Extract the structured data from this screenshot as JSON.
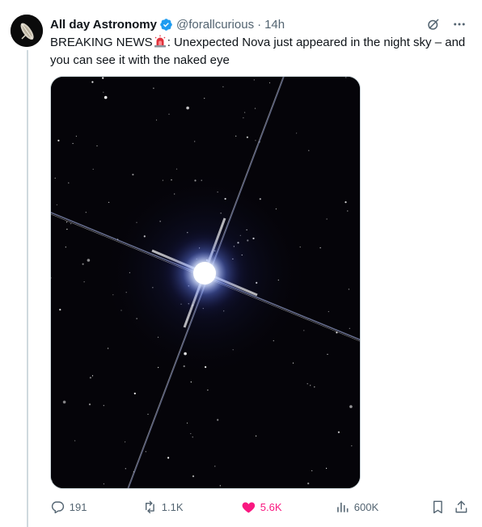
{
  "author": {
    "display_name": "All day Astronomy",
    "handle": "@forallcurious",
    "separator": "·",
    "timestamp": "14h",
    "avatar_icon": "satellite-dish-icon",
    "verified_icon": "verified-badge-icon"
  },
  "tweet": {
    "text_part1": "BREAKING NEWS",
    "emoji_icon": "police-siren-icon",
    "text_part2": ": Unexpected Nova just appeared in the night sky – and you can see it with the naked eye",
    "media_icon": "star-photo-image"
  },
  "top_actions": {
    "grok_icon": "grok-icon",
    "more_icon": "more-options-icon"
  },
  "actions": {
    "replies": "191",
    "reposts": "1.1K",
    "likes": "5.6K",
    "views": "600K",
    "reply_icon": "reply-icon",
    "repost_icon": "repost-icon",
    "like_icon": "heart-icon",
    "views_icon": "analytics-icon",
    "bookmark_icon": "bookmark-icon",
    "share_icon": "share-icon"
  },
  "colors": {
    "text": "#0f1419",
    "secondary": "#536471",
    "verified": "#1d9bf0",
    "like": "#f91880",
    "thread_line": "#cfd9de"
  }
}
